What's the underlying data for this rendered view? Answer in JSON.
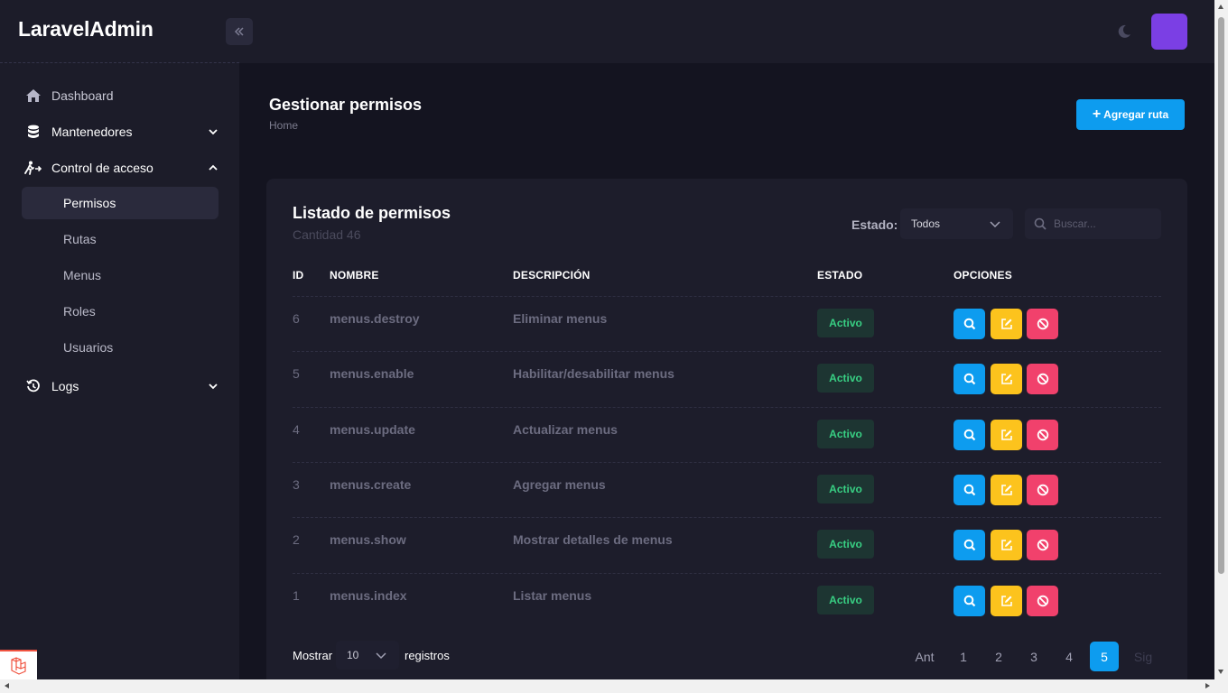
{
  "app": {
    "brand": "LaravelAdmin"
  },
  "sidebar": {
    "items": [
      {
        "label": "Dashboard",
        "icon": "home-icon"
      },
      {
        "label": "Mantenedores",
        "icon": "database-icon"
      },
      {
        "label": "Control de acceso",
        "icon": "person-walking-arrow-icon"
      },
      {
        "label": "Logs",
        "icon": "history-icon"
      }
    ],
    "subitems": [
      {
        "label": "Permisos",
        "active": true
      },
      {
        "label": "Rutas"
      },
      {
        "label": "Menus"
      },
      {
        "label": "Roles"
      },
      {
        "label": "Usuarios"
      }
    ]
  },
  "page": {
    "title": "Gestionar permisos",
    "breadcrumb": "Home",
    "add_button": "Agregar ruta"
  },
  "card": {
    "title": "Listado de permisos",
    "subtitle": "Cantidad 46",
    "estado_label": "Estado:",
    "estado_value": "Todos",
    "search_placeholder": "Buscar..."
  },
  "table": {
    "headers": [
      "ID",
      "NOMBRE",
      "DESCRIPCIÓN",
      "ESTADO",
      "OPCIONES"
    ],
    "rows": [
      {
        "id": "6",
        "nombre": "menus.destroy",
        "descripcion": "Eliminar menus",
        "estado": "Activo"
      },
      {
        "id": "5",
        "nombre": "menus.enable",
        "descripcion": "Habilitar/desabilitar menus",
        "estado": "Activo"
      },
      {
        "id": "4",
        "nombre": "menus.update",
        "descripcion": "Actualizar menus",
        "estado": "Activo"
      },
      {
        "id": "3",
        "nombre": "menus.create",
        "descripcion": "Agregar menus",
        "estado": "Activo"
      },
      {
        "id": "2",
        "nombre": "menus.show",
        "descripcion": "Mostrar detalles de menus",
        "estado": "Activo"
      },
      {
        "id": "1",
        "nombre": "menus.index",
        "descripcion": "Listar menus",
        "estado": "Activo"
      }
    ]
  },
  "footer": {
    "mostrar": "Mostrar",
    "per_page": "10",
    "registros": "registros",
    "prev": "Ant",
    "pages": [
      "1",
      "2",
      "3",
      "4",
      "5"
    ],
    "current_page": "5",
    "next": "Sig"
  },
  "colors": {
    "primary": "#0d9cef",
    "warning": "#fcc31d",
    "danger": "#f1416c",
    "success_text": "#38cf83",
    "avatar": "#7b3fe4"
  }
}
